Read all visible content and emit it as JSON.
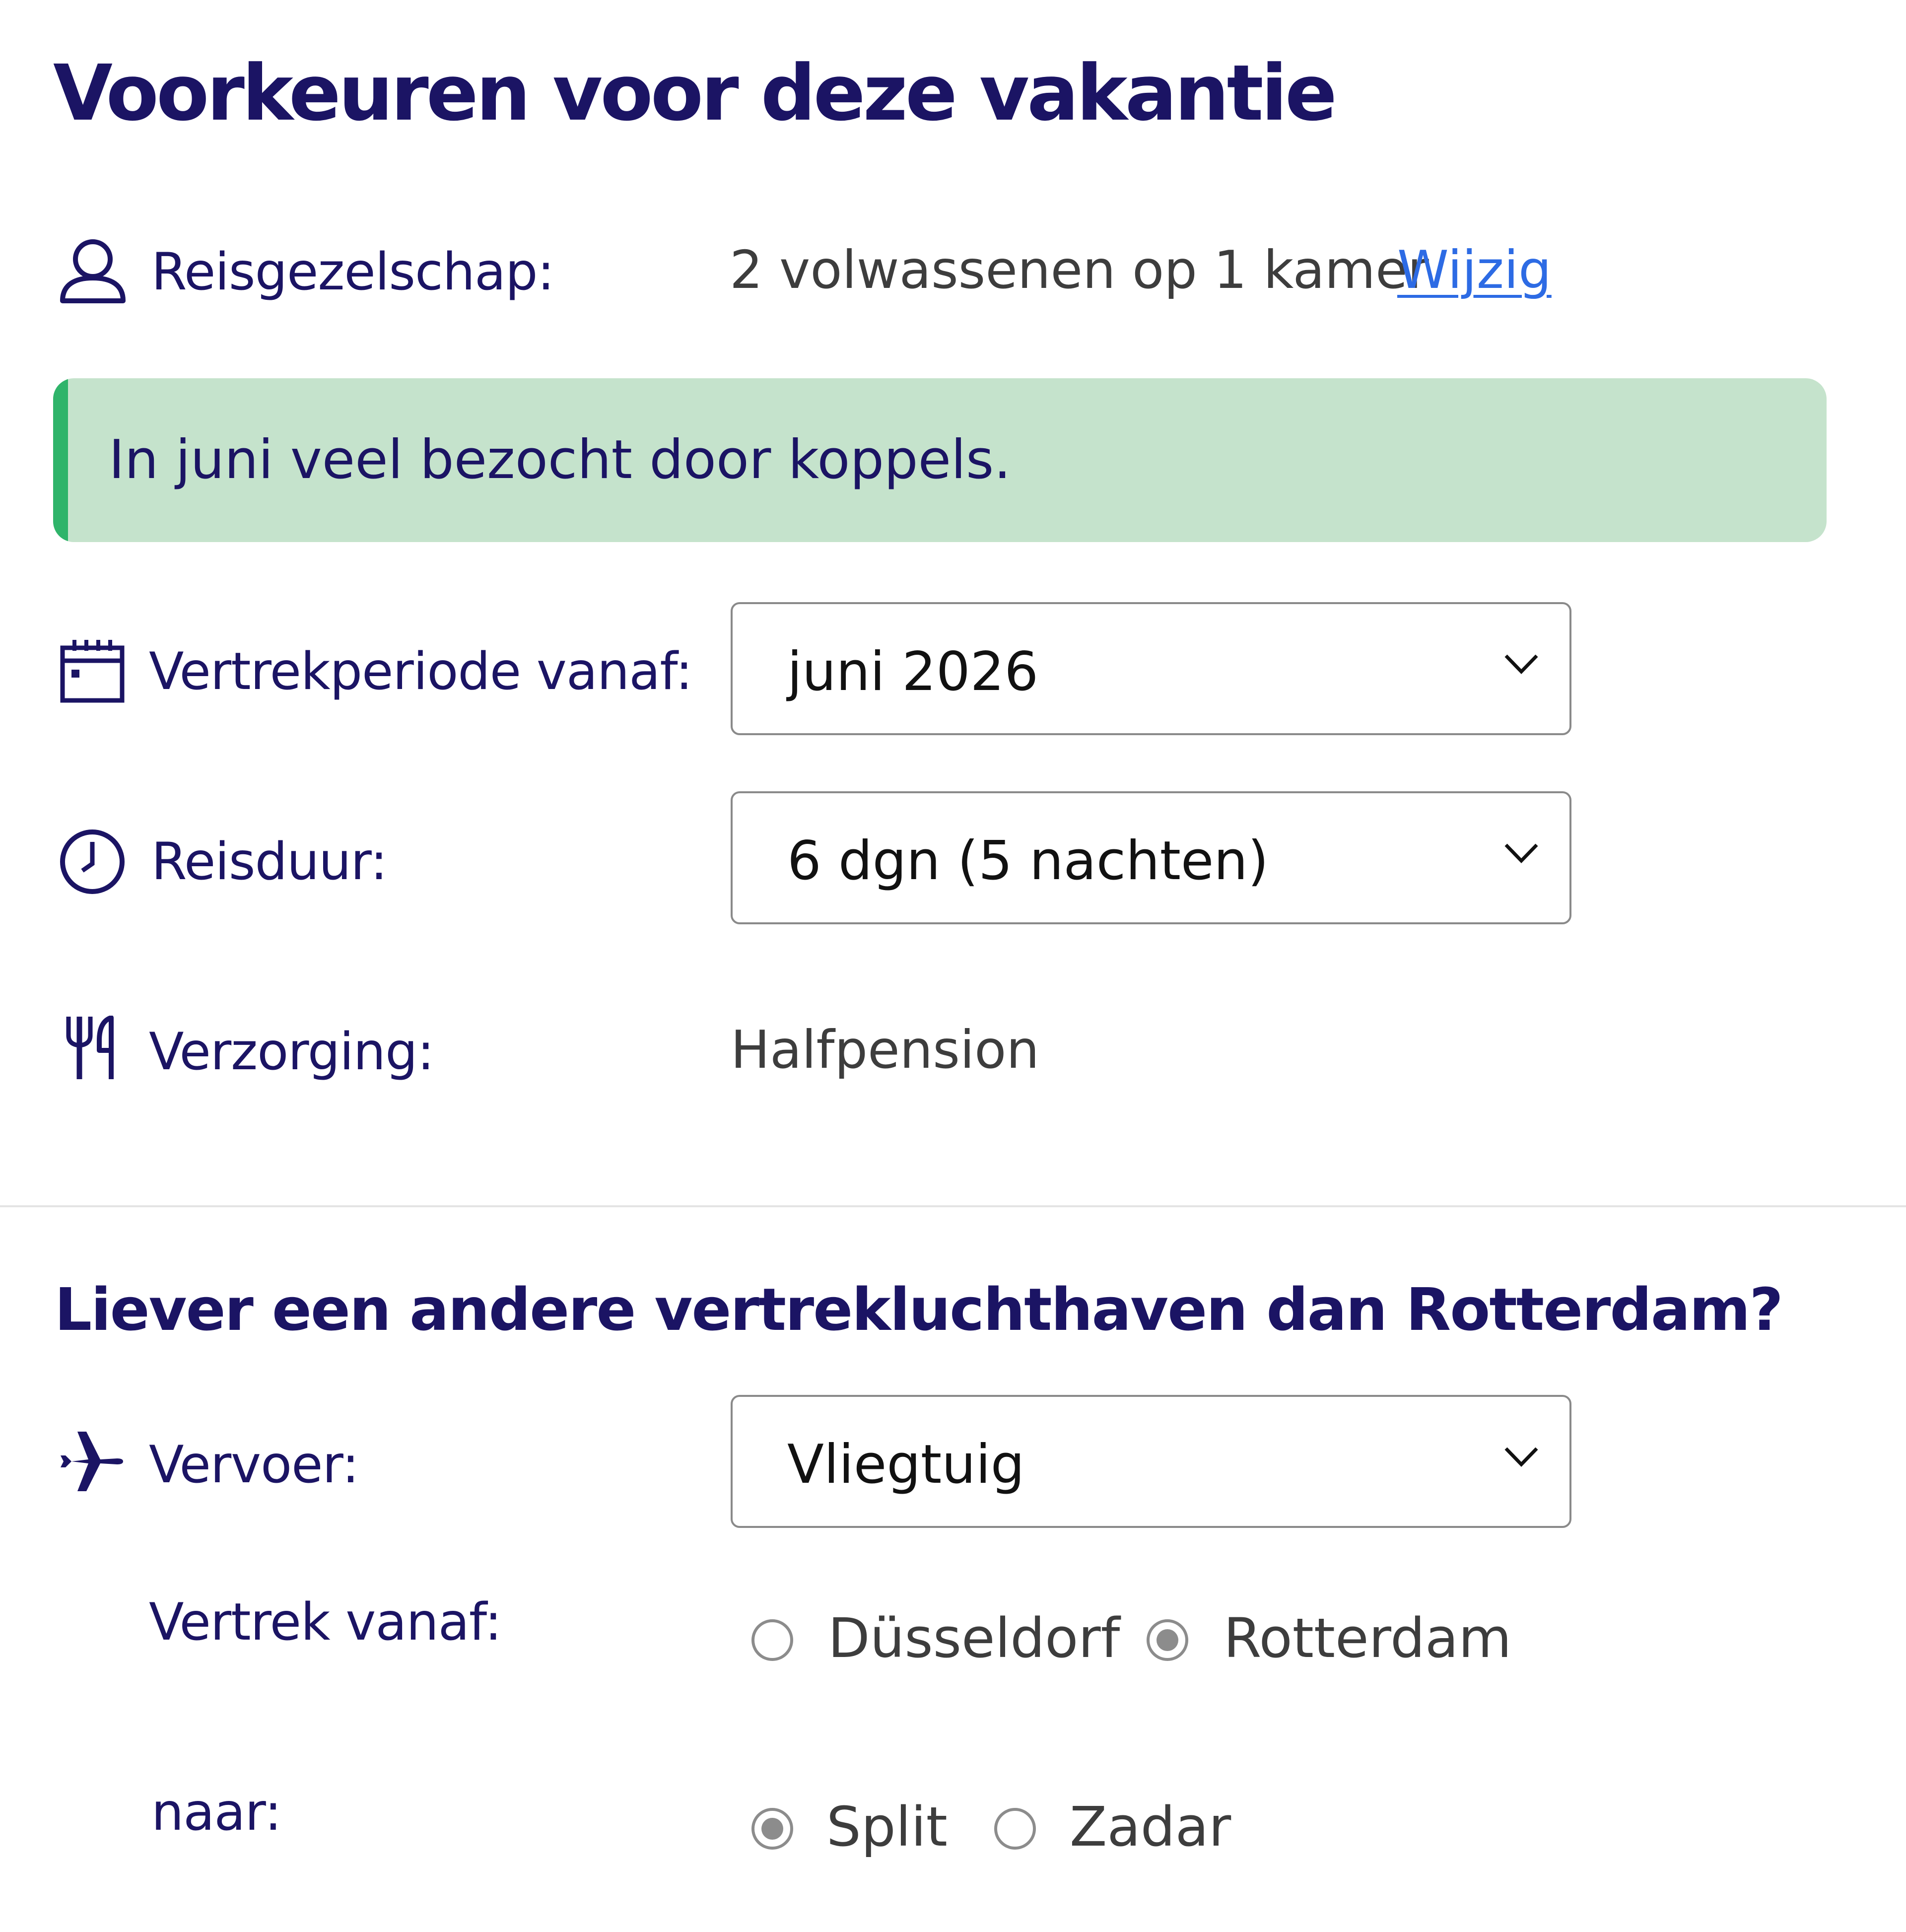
{
  "page": {
    "title": "Voorkeuren voor deze vakantie"
  },
  "party": {
    "label": "Reisgezelschap:",
    "value": "2 volwassenen op 1 kamer",
    "link": "Wijzig",
    "icon": "person-icon"
  },
  "banner": {
    "text": "In juni veel bezocht door koppels.",
    "color": "#c5e3cc",
    "accent": "#2fb46a"
  },
  "departure": {
    "label": "Vertrekperiode vanaf:",
    "value": "juni 2026",
    "icon": "calendar-icon"
  },
  "duration": {
    "label": "Reisduur:",
    "value": "6 dgn (5 nachten)",
    "icon": "clock-icon"
  },
  "board": {
    "label": "Verzorging:",
    "value": "Halfpension",
    "icon": "cutlery-icon"
  },
  "airport": {
    "heading": "Liever een andere vertrekluchthaven dan Rotterdam?"
  },
  "transport": {
    "label": "Vervoer:",
    "value": "Vliegtuig",
    "icon": "plane-icon"
  },
  "from": {
    "label": "Vertrek vanaf:",
    "options": [
      {
        "label": "Düsseldorf",
        "checked": false
      },
      {
        "label": "Rotterdam",
        "checked": true
      }
    ]
  },
  "to": {
    "label": "naar:",
    "options": [
      {
        "label": "Split",
        "checked": true
      },
      {
        "label": "Zadar",
        "checked": false
      }
    ]
  },
  "colors": {
    "text": "#1b1464",
    "link": "#2d6be4",
    "muted": "#3d3d3d"
  }
}
